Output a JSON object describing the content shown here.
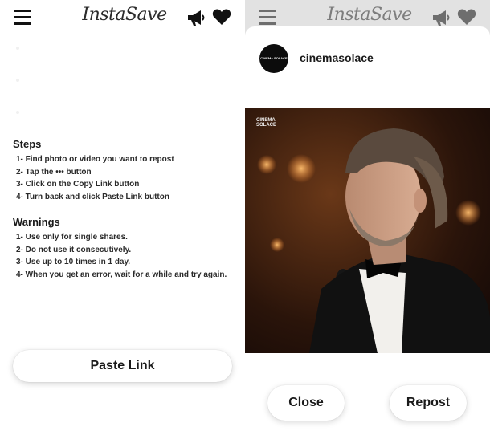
{
  "app": {
    "brand": "InstaSave"
  },
  "icons": {
    "menu": "hamburger-menu-icon",
    "announce": "megaphone-icon",
    "favorites": "heart-icon"
  },
  "colors": {
    "text": "#1a1a1a",
    "background": "#ffffff",
    "overlay": "#e2e2e2",
    "avatar": "#0c0c0c"
  },
  "instructions": {
    "steps_title": "Steps",
    "steps": [
      "1- Find photo or video you want to repost",
      "2- Tap the ••• button",
      "3- Click on the Copy Link button",
      "4- Turn back and click Paste Link button"
    ],
    "warnings_title": "Warnings",
    "warnings": [
      "1- Use only for single shares.",
      "2- Do not use it consecutively.",
      "3- Use up to 10 times in 1 day.",
      "4- When you get an error, wait for a while and try again."
    ],
    "paste_label": "Paste Link"
  },
  "post": {
    "username": "cinemasolace",
    "avatar_text": "CINEMA SOLACE",
    "watermark": "CINEMA SOLACE",
    "close_label": "Close",
    "repost_label": "Repost"
  }
}
